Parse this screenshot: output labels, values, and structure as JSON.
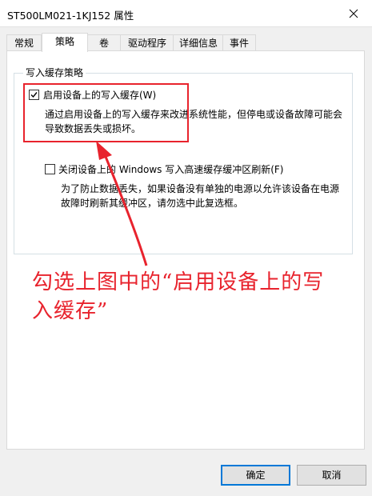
{
  "window": {
    "title": "ST500LM021-1KJ152 属性"
  },
  "tabs": [
    {
      "label": "常规"
    },
    {
      "label": "策略",
      "active": true
    },
    {
      "label": "卷"
    },
    {
      "label": "驱动程序"
    },
    {
      "label": "详细信息"
    },
    {
      "label": "事件"
    }
  ],
  "policy": {
    "group_title": "写入缓存策略",
    "option1": {
      "label": "启用设备上的写入缓存(W)",
      "checked": true,
      "desc_line1": "通过启用设备上的写入缓存来改进系统性能，但停电或设备故障可能会",
      "desc_line2": "导致数据丢失或损坏。"
    },
    "option2": {
      "label": "关闭设备上的 Windows 写入高速缓存缓冲区刷新(F)",
      "checked": false,
      "desc_line1": "为了防止数据丢失，如果设备没有单独的电源以允许该设备在电源",
      "desc_line2": "故障时刷新其缓冲区，请勿选中此复选框。"
    }
  },
  "annotation": {
    "line1": "勾选上图中的“启用设备上的写",
    "line2": "入缓存”",
    "color": "#e8232d"
  },
  "buttons": {
    "ok": "确定",
    "cancel": "取消"
  },
  "icons": {
    "close": "close-icon",
    "check": "checkmark-icon"
  }
}
